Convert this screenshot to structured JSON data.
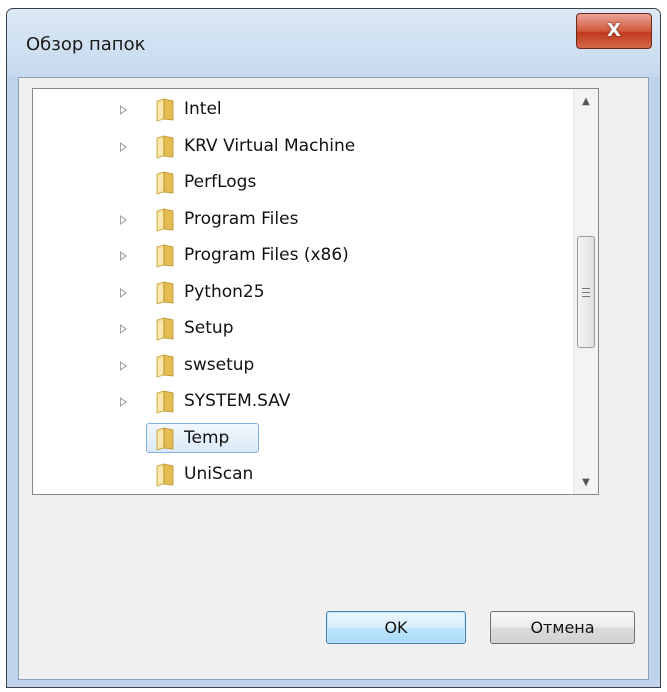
{
  "window": {
    "title": "Обзор папок",
    "close_label": "X"
  },
  "tree": {
    "items": [
      {
        "label": "Intel",
        "has_children": true
      },
      {
        "label": "KRV Virtual Machine",
        "has_children": true
      },
      {
        "label": "PerfLogs",
        "has_children": false
      },
      {
        "label": "Program Files",
        "has_children": true
      },
      {
        "label": "Program Files (x86)",
        "has_children": true
      },
      {
        "label": "Python25",
        "has_children": true
      },
      {
        "label": "Setup",
        "has_children": true
      },
      {
        "label": "swsetup",
        "has_children": true
      },
      {
        "label": "SYSTEM.SAV",
        "has_children": true
      },
      {
        "label": "Temp",
        "has_children": false,
        "selected": true
      },
      {
        "label": "UniScan",
        "has_children": false
      }
    ]
  },
  "scrollbar": {
    "up_icon": "scroll-up-arrow-icon",
    "down_icon": "scroll-down-arrow-icon"
  },
  "buttons": {
    "ok_label": "OK",
    "cancel_label": "Отмена"
  },
  "colors": {
    "folder": "#e8c55a",
    "selection_border": "#84acdd"
  }
}
